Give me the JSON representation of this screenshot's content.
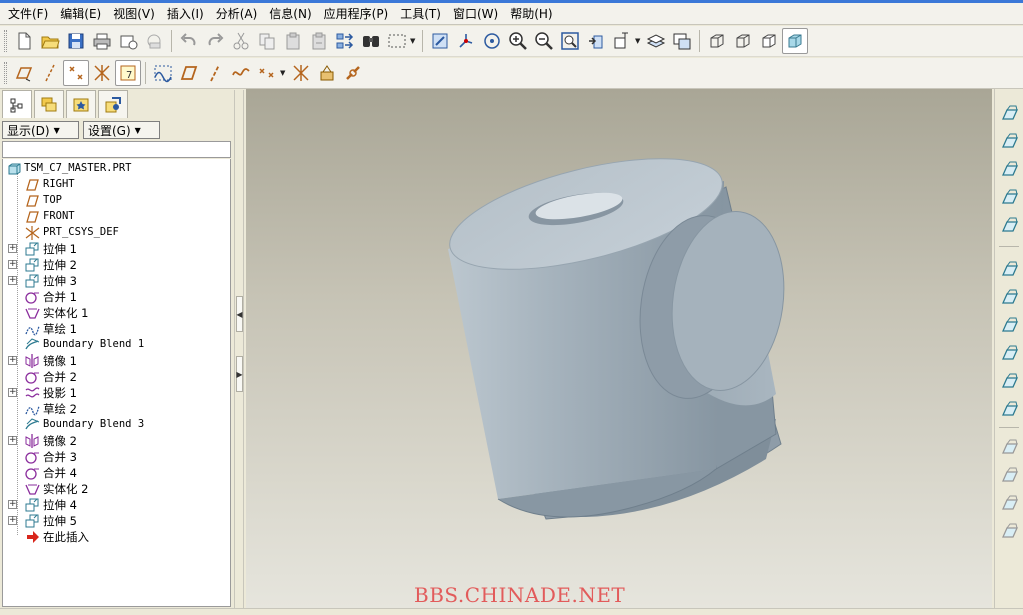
{
  "menu": [
    "文件(F)",
    "编辑(E)",
    "视图(V)",
    "插入(I)",
    "分析(A)",
    "信息(N)",
    "应用程序(P)",
    "工具(T)",
    "窗口(W)",
    "帮助(H)"
  ],
  "toolbar_top": {
    "icons": [
      "new-file-icon",
      "open-folder-icon",
      "save-icon",
      "print-icon",
      "send-mail-icon",
      "undo-icon",
      "redo-icon",
      "cut-icon",
      "copy-icon",
      "paste-icon",
      "paste-special-icon",
      "regenerate-icon",
      "find-icon",
      "select-box-icon",
      "repaint-icon",
      "spin-center-icon",
      "orient-icon",
      "zoom-in-icon",
      "zoom-out-icon",
      "refit-icon",
      "reorient-icon",
      "saved-views-icon",
      "layers-icon",
      "view-manager-icon",
      "wireframe-icon",
      "hidden-line-icon",
      "no-hidden-icon",
      "shading-icon"
    ]
  },
  "toolbar_datum": {
    "icons": [
      "datum-planes-icon",
      "datum-axes-icon",
      "datum-points-icon",
      "coordinate-systems-icon",
      "annotations-icon",
      "sketch-tool-icon",
      "datum-plane-tool-icon",
      "datum-axis-tool-icon",
      "datum-curve-tool-icon",
      "datum-point-tool-icon",
      "csys-tool-icon",
      "analysis-feature-icon",
      "chain-icon"
    ]
  },
  "panel": {
    "tabs": [
      "model-tree-tab",
      "layers-tab",
      "favorites-tab",
      "connections-tab"
    ],
    "show_button": "显示(D)",
    "settings_button": "设置(G)"
  },
  "tree": {
    "root": "TSM_C7_MASTER.PRT",
    "items": [
      {
        "label": "RIGHT",
        "icon": "datum-plane-icon",
        "expandable": false
      },
      {
        "label": "TOP",
        "icon": "datum-plane-icon",
        "expandable": false
      },
      {
        "label": "FRONT",
        "icon": "datum-plane-icon",
        "expandable": false
      },
      {
        "label": "PRT_CSYS_DEF",
        "icon": "csys-icon",
        "expandable": false
      },
      {
        "label": "拉伸 1",
        "icon": "extrude-icon",
        "expandable": true
      },
      {
        "label": "拉伸 2",
        "icon": "extrude-icon",
        "expandable": true
      },
      {
        "label": "拉伸 3",
        "icon": "extrude-icon",
        "expandable": true
      },
      {
        "label": "合并 1",
        "icon": "merge-icon",
        "expandable": false
      },
      {
        "label": "实体化 1",
        "icon": "solidify-icon",
        "expandable": false
      },
      {
        "label": "草绘 1",
        "icon": "sketch-icon",
        "expandable": false
      },
      {
        "label": "Boundary Blend 1",
        "icon": "boundary-blend-icon",
        "expandable": false
      },
      {
        "label": "镜像 1",
        "icon": "mirror-icon",
        "expandable": true
      },
      {
        "label": "合并 2",
        "icon": "merge-icon",
        "expandable": false
      },
      {
        "label": "投影 1",
        "icon": "projection-icon",
        "expandable": true
      },
      {
        "label": "草绘 2",
        "icon": "sketch-icon",
        "expandable": false
      },
      {
        "label": "Boundary Blend 3",
        "icon": "boundary-blend-icon",
        "expandable": false
      },
      {
        "label": "镜像 2",
        "icon": "mirror-icon",
        "expandable": true
      },
      {
        "label": "合并 3",
        "icon": "merge-icon",
        "expandable": false
      },
      {
        "label": "合并 4",
        "icon": "merge-icon",
        "expandable": false
      },
      {
        "label": "实体化 2",
        "icon": "solidify-icon",
        "expandable": false
      },
      {
        "label": "拉伸 4",
        "icon": "extrude-icon",
        "expandable": true
      },
      {
        "label": "拉伸 5",
        "icon": "extrude-icon",
        "expandable": true
      },
      {
        "label": "在此插入",
        "icon": "insert-here-icon",
        "expandable": false
      }
    ]
  },
  "viewport": {
    "watermark": "BBS.CHINADE.NET",
    "model_color": "#9aa8b3",
    "background": "#c6c3b5"
  },
  "right_toolbar": {
    "icons": [
      "hole-tool-icon",
      "shell-tool-icon",
      "rib-tool-icon",
      "draft-tool-icon",
      "round-tool-icon",
      "extrude-tool-icon",
      "revolve-tool-icon",
      "variable-section-sweep-icon",
      "boundary-blend-tool-icon",
      "style-tool-icon",
      "chamfer-tool-icon",
      "mirror-tool-icon",
      "merge-tool-icon",
      "trim-tool-icon",
      "pattern-tool-icon"
    ]
  }
}
